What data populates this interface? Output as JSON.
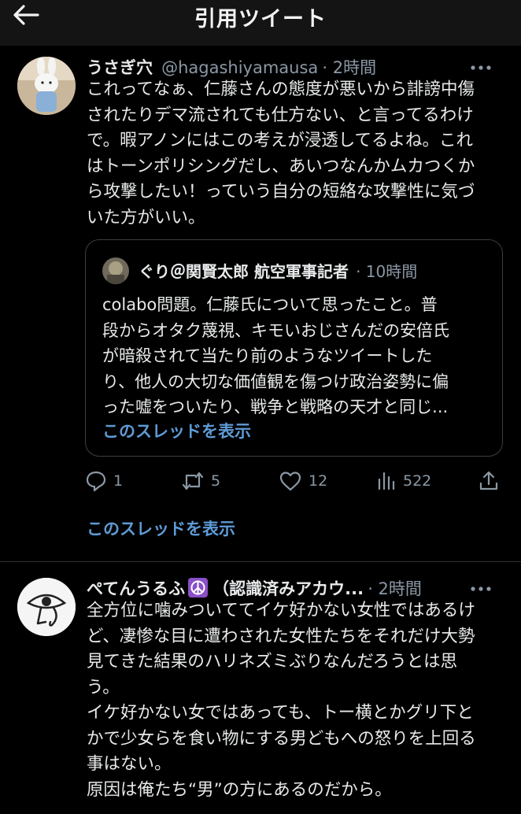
{
  "header": {
    "title": "引用ツイート"
  },
  "tweet1": {
    "name": "うさぎ穴",
    "handle": "@hagashiyamausa",
    "time": "· 2時間",
    "lines": [
      "これってなぁ、仁藤さんの態度が悪いから誹謗中傷",
      "されたりデマ流されても仕方ない、と言ってるわけ",
      "で。暇アノンにはこの考えが浸透してるよね。これ",
      "はトーンポリシングだし、あいつなんかムカつくか",
      "ら攻撃したい！っていう自分の短絡な攻撃性に気づ",
      "いた方がいい。"
    ],
    "quote": {
      "name": "ぐり＠関賢太郎 航空軍事記者",
      "time": "· 10時間",
      "lines": [
        "colabo問題。仁藤氏について思ったこと。普",
        "段からオタク蔑視、キモいおじさんだの安倍氏",
        "が暗殺されて当たり前のようなツイートした",
        "り、他人の大切な価値観を傷つけ政治姿勢に偏",
        "った嘘をついたり、戦争と戦略の天才と同じ..."
      ],
      "thread_link": "このスレッドを表示"
    },
    "actions": {
      "replies": "1",
      "retweets": "5",
      "likes": "12",
      "views": "522"
    },
    "thread_link": "このスレッドを表示"
  },
  "tweet2": {
    "name": "ぺてんうるふ",
    "name_suffix": "（認識済みアカウ...",
    "time": "· 2時間",
    "lines": [
      "全方位に噛みついててイケ好かない女性ではあるけ",
      "ど、凄惨な目に遭わされた女性たちをそれだけ大勢",
      "見てきた結果のハリネズミぶりなんだろうとは思",
      "う。",
      "イケ好かない女ではあっても、トー横とかグリ下と",
      "かで少女らを食い物にする男どもへの怒りを上回る",
      "事はない。",
      "原因は俺たち“男”の方にあるのだから。"
    ]
  },
  "colors": {
    "background": "#000000",
    "link": "#5e9bd6",
    "muted": "#8b98a5"
  }
}
